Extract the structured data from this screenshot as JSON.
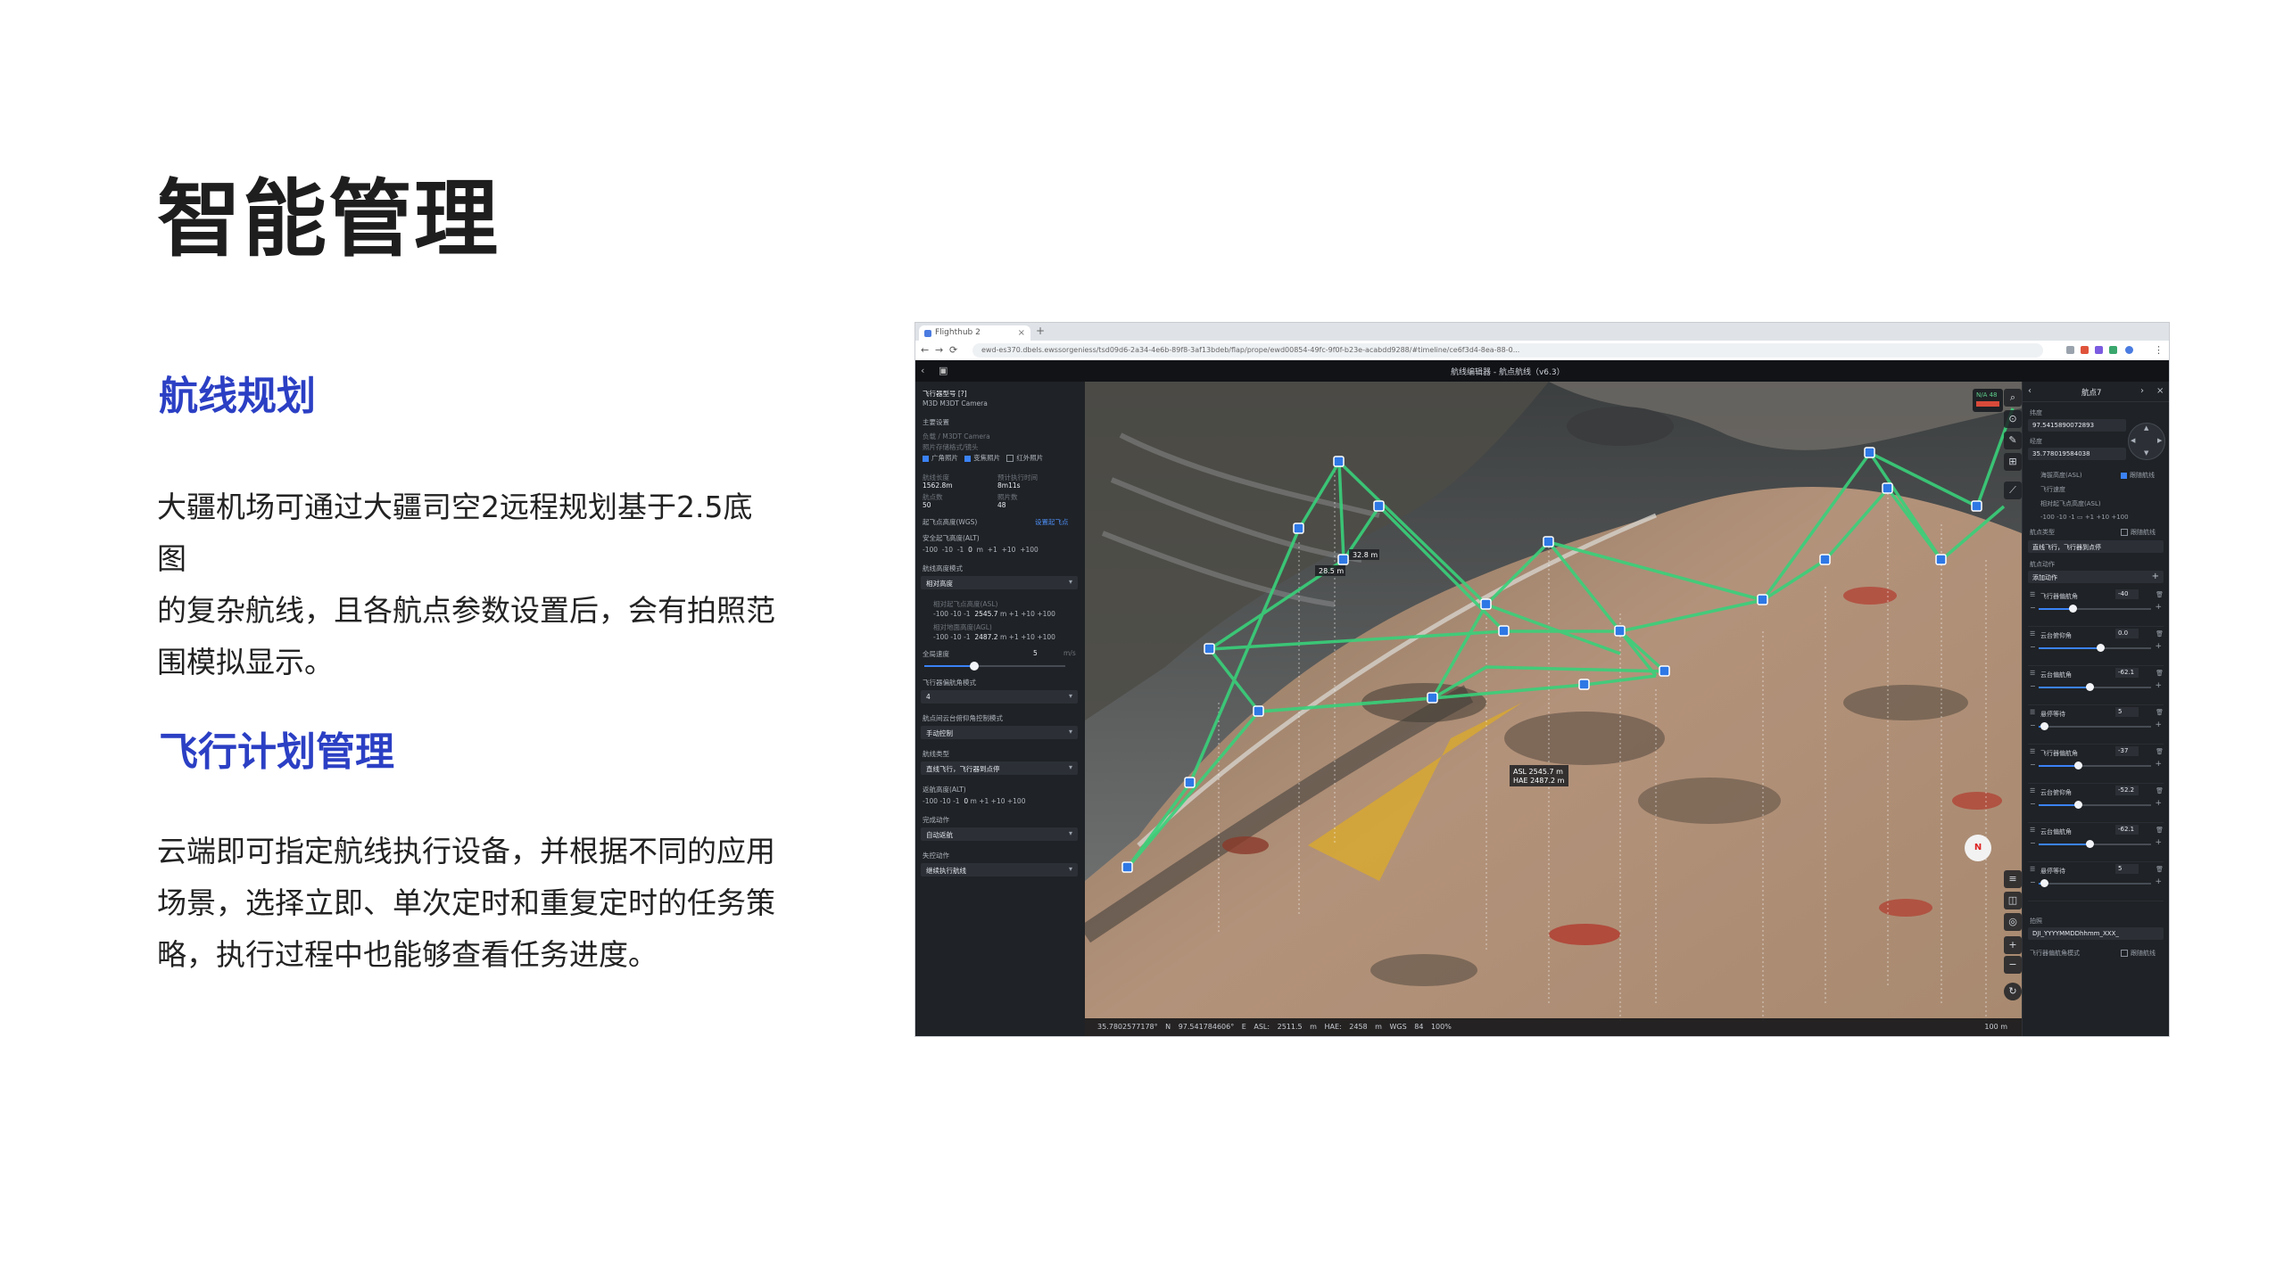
{
  "page": {
    "title": "智能管理",
    "sections": [
      {
        "heading": "航线规划",
        "lines": [
          "大疆机场可通过大疆司空2远程规划基于2.5底图",
          "的复杂航线，且各航点参数设置后，会有拍照范",
          "围模拟显示。"
        ]
      },
      {
        "heading": "飞行计划管理",
        "lines": [
          "云端即可指定航线执行设备，并根据不同的应用",
          "场景，选择立即、单次定时和重复定时的任务策",
          "略，执行过程中也能够查看任务进度。"
        ]
      }
    ]
  },
  "screenshot": {
    "browser": {
      "tab_label": "Flighthub 2",
      "new_tab": "+",
      "url": "ewd-es370.dbels.ewssorgeniess/tsd09d6-2a34-4e6b-89f8-3af13bdeb/flap/prope/ewd00854-49fc-9f0f-b23e-acabdd9288/#timeline/ce6f3d4-8ea-88-0...",
      "icons": {
        "back": "back-arrow-icon",
        "forward": "forward-arrow-icon",
        "reload": "reload-icon"
      }
    },
    "app": {
      "title": "航线编辑器 - 航点航线（v6.3）"
    },
    "left_panel": {
      "aircraft": "飞行器型号 [?]",
      "camera": "M3D  M3DT Camera",
      "section_general": "主要设置",
      "lens_label": "负载 / M3DT Camera",
      "photo_label": "照片存储格式/镜头",
      "photo_opts": [
        "广角照片",
        "变焦照片",
        "红外照片"
      ],
      "stats_labels": [
        "航线长度",
        "预计执行时间"
      ],
      "stats_values": [
        "1562.8m",
        "8m11s"
      ],
      "stats_labels2": [
        "航点数",
        "照片数"
      ],
      "stats_values2": [
        "50",
        "48"
      ],
      "takeoff_label": "起飞点高度(WGS)",
      "takeoff_link": "设置起飞点",
      "safe_height_label": "安全起飞高度(ALT)",
      "safe_height_value": "0",
      "steps": [
        "-100",
        "-10",
        "-1",
        "m",
        "+1",
        "+10",
        "+100"
      ],
      "alt_mode_label": "航线高度模式",
      "alt_mode_value": "相对高度",
      "height_label_a": "相对起飞点高度(ASL)",
      "height_value_a": "2545.7",
      "height_label_b": "相对地面高度(AGL)",
      "height_value_b": "2487.2",
      "speed_label": "全局速度",
      "speed_value": "5",
      "speed_unit": "m/s",
      "lost_label": "飞行器偏航角模式",
      "lost_value": "4",
      "yaw_label": "航点间云台俯仰角控制模式",
      "yaw_value": "手动控制",
      "finish_label": "航线类型",
      "finish_value": "直线飞行，飞行器到点停",
      "rth_label": "返航高度(ALT)",
      "rth_value": "0",
      "signal_label": "完成动作",
      "signal_value": "自动返航",
      "lost2_label": "失控动作",
      "lost2_value": "继续执行航线"
    },
    "map": {
      "waypoint_labels": [
        "28.5 m",
        "32.8 m"
      ],
      "info_popup_lines": [
        "ASL 2545.7 m",
        "HAE 2487.2 m"
      ],
      "badge": "N/A  48",
      "compass_label": "N",
      "status": "35.7802577178° N   97.541784606° E   ASL: 2511.5 m   HAE: 2458 m   WGS 84   100%",
      "scale": "100 m"
    },
    "right_panel": {
      "title": "航点7",
      "lat_label": "纬度",
      "lat_value": "97.5415890072893",
      "lon_label": "经度",
      "lon_value": "35.778019584038",
      "alt_label": "海拔高度(ASL)",
      "alt_follow": "跟随航线",
      "speed_label": "飞行速度",
      "height_label": "相对起飞点高度(ASL)",
      "follow_route": "跟随航线",
      "turn_label": "航点类型",
      "turn_value": "直线飞行，飞行器到点停",
      "actions_label": "航点动作",
      "actions_value": "添加动作",
      "actions": [
        {
          "name": "飞行器偏航角",
          "value": "-40",
          "fill": 0.3
        },
        {
          "name": "云台俯仰角",
          "value": "0.0",
          "fill": 0.55
        },
        {
          "name": "云台偏航角",
          "value": "-62.1",
          "fill": 0.45
        },
        {
          "name": "悬停等待",
          "value": "5",
          "fill": 0.05
        },
        {
          "name": "飞行器偏航角",
          "value": "-37",
          "fill": 0.35
        },
        {
          "name": "云台俯仰角",
          "value": "-52.2",
          "fill": 0.35
        },
        {
          "name": "云台偏航角",
          "value": "-62.1",
          "fill": 0.45
        },
        {
          "name": "悬停等待",
          "value": "5",
          "fill": 0.05
        }
      ],
      "file_label": "拍照",
      "file_value": "DJI_YYYYMMDDhhmm_XXX_",
      "bottom_label": "飞行器偏航角模式",
      "bottom_check": "跟随航线"
    }
  }
}
